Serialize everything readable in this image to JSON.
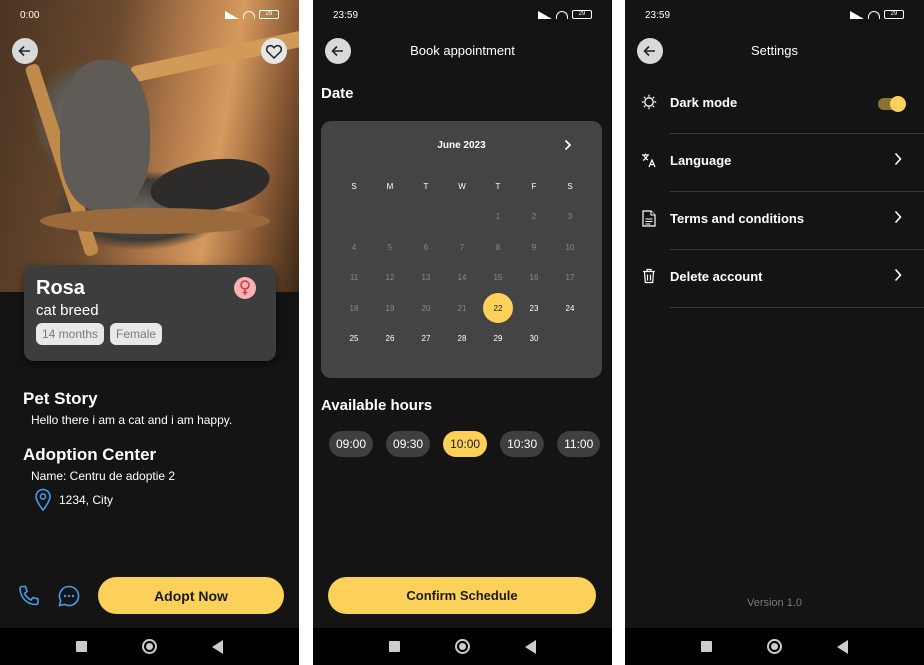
{
  "screen1": {
    "status": {
      "time": "0:00",
      "battery": "29"
    },
    "pet": {
      "name": "Rosa",
      "breed": "cat breed",
      "age_chip": "14 months",
      "sex_chip": "Female"
    },
    "story": {
      "title": "Pet Story",
      "text": "Hello there i am a cat and i am happy."
    },
    "center": {
      "title": "Adoption Center",
      "name": "Name: Centru de adoptie 2",
      "address": "1234, City"
    },
    "adopt_label": "Adopt Now",
    "colors": {
      "accent": "#fcd15a",
      "icon_blue": "#4a9be8"
    }
  },
  "screen2": {
    "status": {
      "time": "23:59",
      "battery": "29"
    },
    "title": "Book appointment",
    "date_label": "Date",
    "calendar": {
      "month": "June 2023",
      "weekdays": [
        "S",
        "M",
        "T",
        "W",
        "T",
        "F",
        "S"
      ],
      "rows": [
        [
          "",
          "",
          "",
          "",
          "1",
          "2",
          "3"
        ],
        [
          "4",
          "5",
          "6",
          "7",
          "8",
          "9",
          "10"
        ],
        [
          "11",
          "12",
          "13",
          "14",
          "15",
          "16",
          "17"
        ],
        [
          "18",
          "19",
          "20",
          "21",
          "22",
          "23",
          "24"
        ],
        [
          "25",
          "26",
          "27",
          "28",
          "29",
          "30",
          ""
        ]
      ],
      "selected": "22",
      "first_enabled": 22
    },
    "hours_label": "Available hours",
    "hours": [
      "09:00",
      "09:30",
      "10:00",
      "10:30",
      "11:00"
    ],
    "selected_hour": "10:00",
    "confirm_label": "Confirm Schedule"
  },
  "screen3": {
    "status": {
      "time": "23:59",
      "battery": "29"
    },
    "title": "Settings",
    "items": [
      {
        "label": "Dark mode",
        "icon": "brightness-icon"
      },
      {
        "label": "Language",
        "icon": "translate-icon"
      },
      {
        "label": "Terms and conditions",
        "icon": "document-icon"
      },
      {
        "label": "Delete account",
        "icon": "trash-icon"
      }
    ],
    "dark_mode_on": true,
    "version": "Version 1.0"
  }
}
